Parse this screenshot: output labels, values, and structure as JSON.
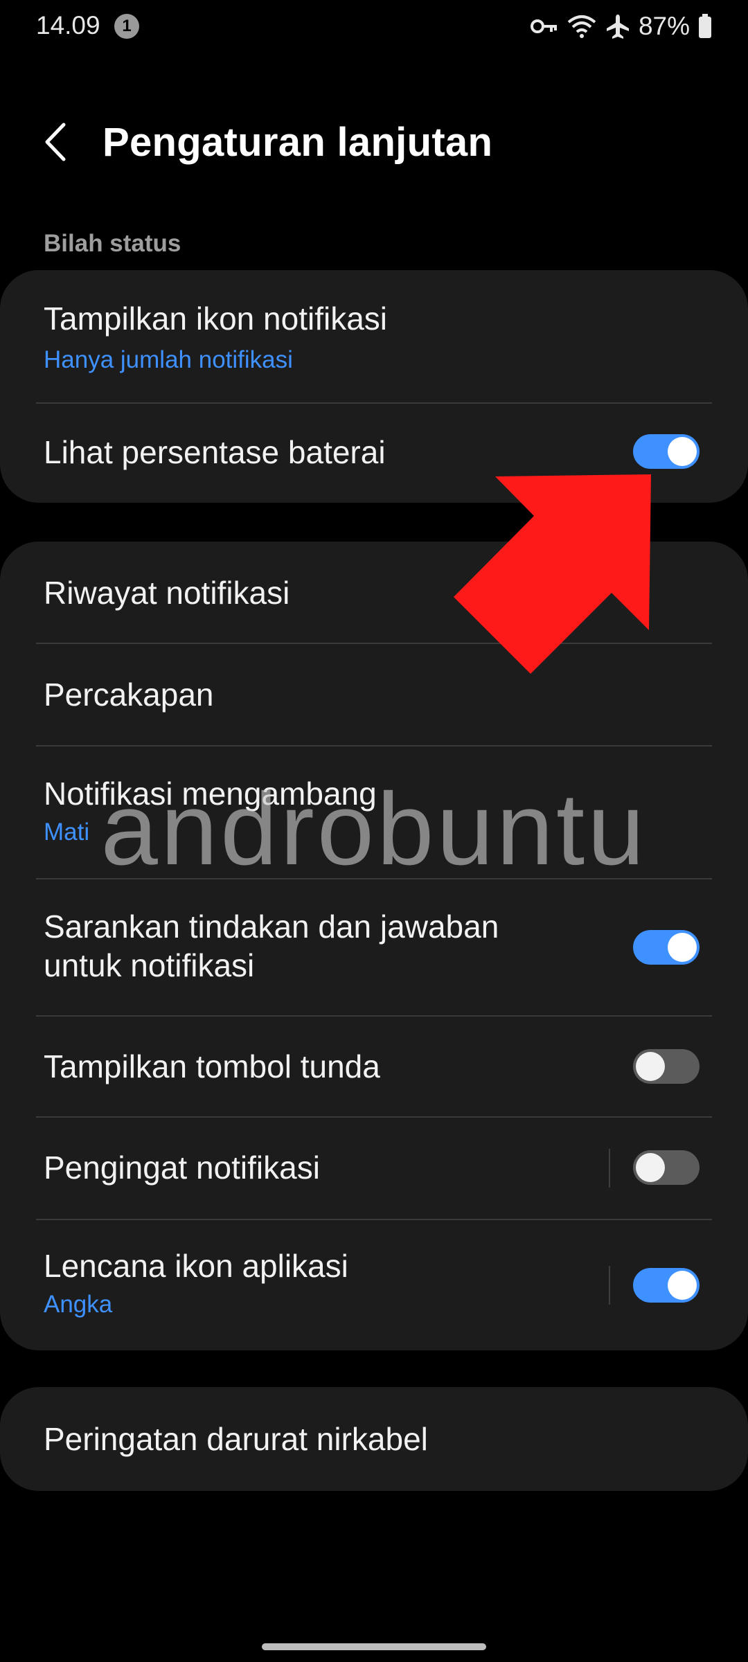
{
  "status_bar": {
    "time": "14.09",
    "notification_count": "1",
    "battery": "87%",
    "icons": [
      "vpn-key-icon",
      "wifi-icon",
      "airplane-icon",
      "battery-icon"
    ]
  },
  "header": {
    "title": "Pengaturan lanjutan",
    "back_icon": "chevron-left-icon"
  },
  "section": {
    "label": "Bilah status"
  },
  "card1": {
    "items": [
      {
        "title": "Tampilkan ikon notifikasi",
        "subtitle": "Hanya jumlah notifikasi"
      },
      {
        "title": "Lihat persentase baterai",
        "toggle": true
      }
    ]
  },
  "card2": {
    "items": [
      {
        "title": "Riwayat notifikasi"
      },
      {
        "title": "Percakapan"
      },
      {
        "title": "Notifikasi mengambang",
        "subtitle": "Mati"
      },
      {
        "title": "Sarankan tindakan dan jawaban untuk notifikasi",
        "toggle": true
      },
      {
        "title": "Tampilkan tombol tunda",
        "toggle": false
      },
      {
        "title": "Pengingat notifikasi",
        "toggle": false
      },
      {
        "title": "Lencana ikon aplikasi",
        "subtitle": "Angka",
        "toggle": true
      }
    ]
  },
  "card3": {
    "items": [
      {
        "title": "Peringatan darurat nirkabel"
      }
    ]
  },
  "watermark": "androbuntu",
  "colors": {
    "background": "#000000",
    "card": "#1c1c1c",
    "accent": "#3e91ff",
    "arrow": "#ff1a1a"
  }
}
